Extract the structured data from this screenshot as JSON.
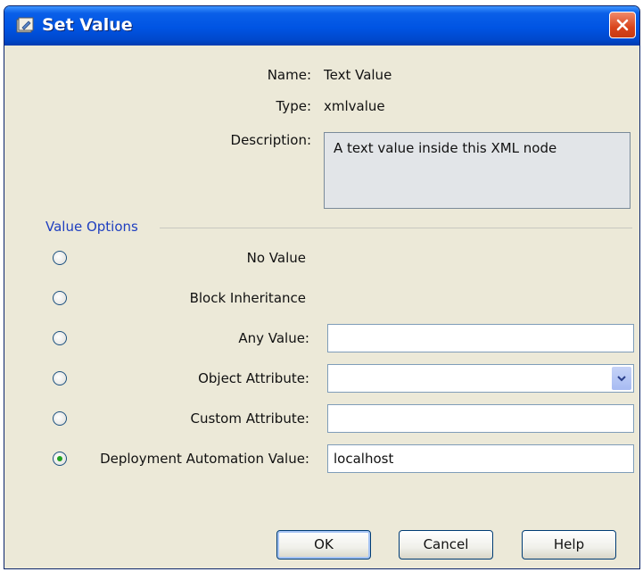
{
  "window": {
    "title": "Set Value"
  },
  "info": {
    "name_label": "Name:",
    "name_value": "Text Value",
    "type_label": "Type:",
    "type_value": "xmlvalue",
    "description_label": "Description:",
    "description_value": "A text value inside this XML node"
  },
  "value_options": {
    "group_title": "Value Options",
    "options": [
      {
        "label": "No Value",
        "selected": false
      },
      {
        "label": "Block Inheritance",
        "selected": false
      },
      {
        "label": "Any Value:",
        "selected": false,
        "value": ""
      },
      {
        "label": "Object Attribute:",
        "selected": false,
        "value": ""
      },
      {
        "label": "Custom Attribute:",
        "selected": false,
        "value": ""
      },
      {
        "label": "Deployment Automation Value:",
        "selected": true,
        "value": "localhost"
      }
    ]
  },
  "buttons": {
    "ok": "OK",
    "cancel": "Cancel",
    "help": "Help"
  },
  "icons": {
    "title": "settings-window-icon",
    "close": "close-icon",
    "dropdown": "chevron-down-icon"
  },
  "colors": {
    "titlebar": "#0054e3",
    "dialog_bg": "#ece9d8",
    "group_title": "#1f3fc0",
    "close": "#d9441c"
  }
}
